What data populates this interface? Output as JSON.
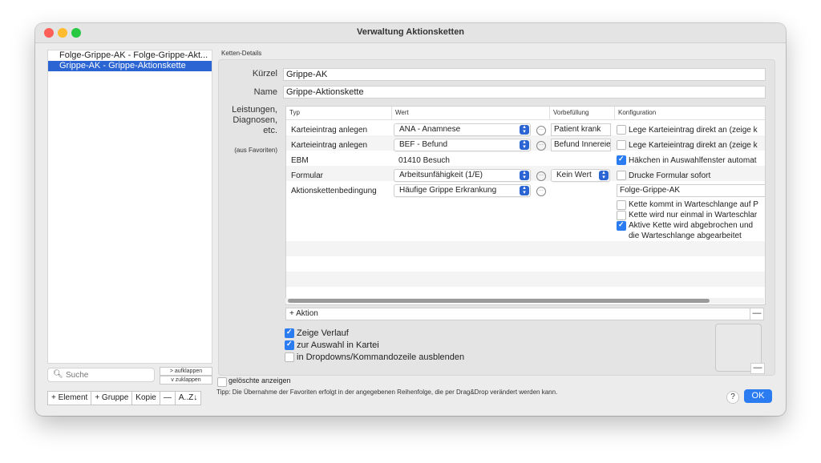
{
  "window": {
    "title": "Verwaltung Aktionsketten"
  },
  "sidebar": {
    "items": [
      {
        "label": "Folge-Grippe-AK - Folge-Grippe-Akt...",
        "selected": false
      },
      {
        "label": "Grippe-AK - Grippe-Aktionskette",
        "selected": true
      }
    ],
    "search_placeholder": "Suche",
    "expand_label": "> aufklappen",
    "collapse_label": "v zuklappen",
    "deleted_label": "gelöschte anzeigen",
    "buttons": [
      "+ Element",
      "+ Gruppe",
      "Kopie",
      "—",
      "A..Z↓"
    ]
  },
  "details": {
    "group_title": "Ketten-Details",
    "kuerzel_label": "Kürzel",
    "kuerzel_value": "Grippe-AK",
    "name_label": "Name",
    "name_value": "Grippe-Aktionskette",
    "services_label_1": "Leistungen,",
    "services_label_2": "Diagnosen,",
    "services_label_3": "etc.",
    "favorites_note": "(aus Favoriten)"
  },
  "table": {
    "headers": [
      "Typ",
      "Wert",
      "Vorbefüllung",
      "Konfiguration"
    ],
    "rows": [
      {
        "typ": "Karteieintrag anlegen",
        "wert": "ANA - Anamnese",
        "vor": "Patient krank",
        "konf": "Lege Karteieintrag direkt an (zeige k",
        "konf_checked": false
      },
      {
        "typ": "Karteieintrag anlegen",
        "wert": "BEF - Befund",
        "vor": "Befund Innereie",
        "konf": "Lege Karteieintrag direkt an (zeige k",
        "konf_checked": false
      },
      {
        "typ": "EBM",
        "wert": "01410 Besuch",
        "vor": "",
        "konf": "Häkchen in Auswahlfenster automat",
        "konf_checked": true
      },
      {
        "typ": "Formular",
        "wert": "Arbeitsunfähigkeit (1/E)",
        "vor": "Kein Wert",
        "konf": "Drucke Formular sofort",
        "konf_checked": false
      },
      {
        "typ": "Aktionskettenbedingung",
        "wert": "Häufige Grippe Erkrankung",
        "vor": "",
        "konf": "Folge-Grippe-AK"
      }
    ],
    "condition_options": [
      {
        "label": "Kette kommt in Warteschlange auf P",
        "checked": false
      },
      {
        "label": "Kette wird nur einmal in Warteschlar",
        "checked": false
      },
      {
        "label": "Aktive Kette wird abgebrochen und",
        "checked": true
      },
      {
        "label": "die Warteschlange abgearbeitet",
        "checked": null
      }
    ],
    "add_action_label": "+ Aktion",
    "remove_label": "—"
  },
  "options": {
    "show_history": {
      "label": "Zeige Verlauf",
      "checked": true
    },
    "select_in_chart": {
      "label": "zur Auswahl in Kartei",
      "checked": true
    },
    "hide_in_dropdowns": {
      "label": "in Dropdowns/Kommandozeile ausblenden",
      "checked": false
    }
  },
  "footer": {
    "tip": "Tipp: Die Übernahme der Favoriten erfolgt in der angegebenen Reihenfolge, die per Drag&Drop verändert werden kann.",
    "help_label": "?",
    "ok_label": "OK",
    "preview_remove_label": "—"
  },
  "colors": {
    "accent": "#2b64d3",
    "checkbox_on": "#2b7bf1"
  }
}
